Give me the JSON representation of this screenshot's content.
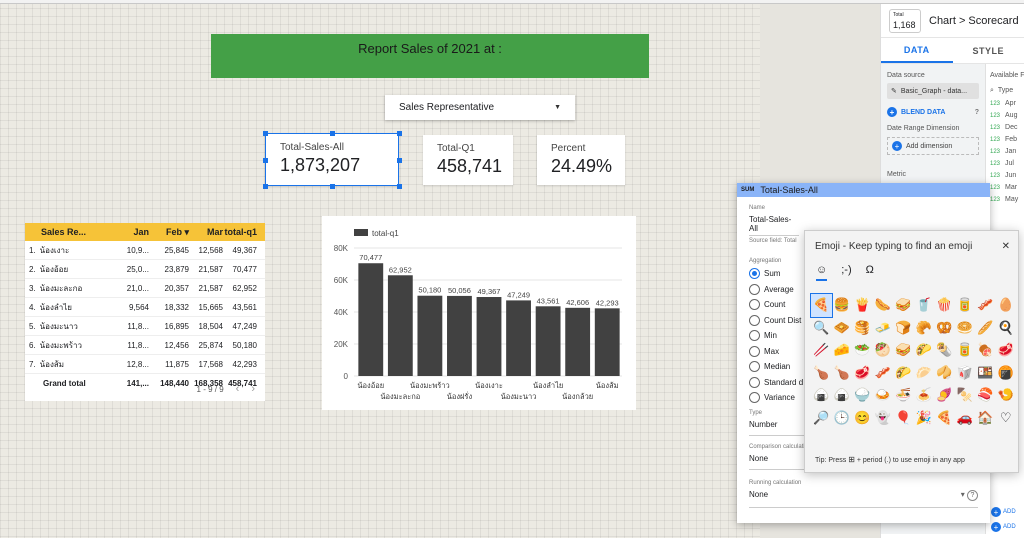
{
  "banner": {
    "title": "Report Sales of  2021 at :"
  },
  "dropdown": {
    "label": "Sales Representative"
  },
  "scorecards": [
    {
      "label": "Total-Sales-All",
      "value": "1,873,207"
    },
    {
      "label": "Total-Q1",
      "value": "458,741"
    },
    {
      "label": "Percent",
      "value": "24.49%"
    }
  ],
  "table": {
    "headers": [
      "Sales Re...",
      "Jan",
      "Feb ▾",
      "Mar",
      "total-q1"
    ],
    "rows": [
      [
        "1.",
        "น้องเงาะ",
        "10,9...",
        "25,845",
        "12,568",
        "49,367"
      ],
      [
        "2.",
        "น้องอ้อย",
        "25,0...",
        "23,879",
        "21,587",
        "70,477"
      ],
      [
        "3.",
        "น้องมะละกอ",
        "21,0...",
        "20,357",
        "21,587",
        "62,952"
      ],
      [
        "4.",
        "น้องลำไย",
        "9,564",
        "18,332",
        "15,665",
        "43,561"
      ],
      [
        "5.",
        "น้องมะนาว",
        "11,8...",
        "16,895",
        "18,504",
        "47,249"
      ],
      [
        "6.",
        "น้องมะพร้าว",
        "11,8...",
        "12,456",
        "25,874",
        "50,180"
      ],
      [
        "7.",
        "น้องส้ม",
        "12,8...",
        "11,875",
        "17,568",
        "42,293"
      ]
    ],
    "total": [
      "Grand total",
      "141,...",
      "148,440",
      "168,358",
      "458,741"
    ],
    "pager": "1 - 9 / 9"
  },
  "chart_data": {
    "type": "bar",
    "legend": "total-q1",
    "categories": [
      "น้องอ้อย",
      "น้องมะละกอ",
      "น้องมะพร้าว",
      "น้องฝรั่ง",
      "น้องเงาะ",
      "น้องมะนาว",
      "น้องลำไย",
      "น้องกล้วย",
      "น้องส้ม"
    ],
    "values": [
      70477,
      62952,
      50180,
      50056,
      49367,
      47249,
      43561,
      42606,
      42293
    ],
    "value_labels": [
      "70,477",
      "62,952",
      "50,180",
      "50,056",
      "49,367",
      "47,249",
      "43,561",
      "42,606",
      "42,293"
    ],
    "yticks": [
      "0",
      "20K",
      "40K",
      "60K",
      "80K"
    ],
    "ylim": [
      0,
      80000
    ],
    "bar_color": "#414141"
  },
  "panel": {
    "thumb_label": "Total",
    "thumb_value": "1,168",
    "crumb": "Chart > Scorecard",
    "tabs": [
      "DATA",
      "STYLE"
    ],
    "data_source_label": "Data source",
    "data_source": "Basic_Graph - data...",
    "blend": "BLEND DATA",
    "date_range": "Date Range Dimension",
    "add_dimension": "Add dimension",
    "metric_label": "Metric",
    "available_fields": "Available Fi",
    "search_placeholder": "Type",
    "field_type": "123",
    "fields": [
      "Apr",
      "Aug",
      "Dec",
      "Feb",
      "Jan",
      "Jul",
      "Jun",
      "Mar",
      "May"
    ],
    "add_labels": [
      "ADD",
      "ADD"
    ]
  },
  "metric_editor": {
    "sum_badge": "SUM",
    "title": "Total-Sales-All",
    "name_label": "Name",
    "name_value": "Total-Sales-All",
    "source_field": "Source field: Total",
    "aggregation_label": "Aggregation",
    "options": [
      "Sum",
      "Average",
      "Count",
      "Count Dist",
      "Min",
      "Max",
      "Median",
      "Standard d",
      "Variance"
    ],
    "type_label": "Type",
    "type_value": "Number",
    "comparison_label": "Comparison calculation",
    "comparison_value": "None",
    "running_label": "Running calculation",
    "running_value": "None"
  },
  "emoji_panel": {
    "title": "Emoji - Keep typing to find an emoji",
    "tabs": [
      "☺",
      ";-)",
      "Ω"
    ],
    "emojis": [
      "🍕",
      "🍔",
      "🍟",
      "🌭",
      "🥪",
      "🥤",
      "🍿",
      "🥫",
      "🥓",
      "🥚",
      "🔍",
      "🧇",
      "🥞",
      "🧈",
      "🍞",
      "🥐",
      "🥨",
      "🥯",
      "🥖",
      "🍳",
      "🥢",
      "🧀",
      "🥗",
      "🥙",
      "🥪",
      "🌮",
      "🌯",
      "🥫",
      "🍖",
      "🥩",
      "🍗",
      "🍗",
      "🥩",
      "🥓",
      "🌮",
      "🥟",
      "🥠",
      "🥡",
      "🍱",
      "🍘",
      "🍙",
      "🍙",
      "🍚",
      "🍛",
      "🍜",
      "🍝",
      "🍠",
      "🍢",
      "🍣",
      "🍤",
      "🔎",
      "🕒",
      "😊",
      "👻",
      "🎈",
      "🎉",
      "🍕",
      "🚗",
      "🏠",
      "♡"
    ],
    "tip_prefix": "Tip: Press",
    "tip_suffix": "+ period (.) to use emoji in any app"
  }
}
